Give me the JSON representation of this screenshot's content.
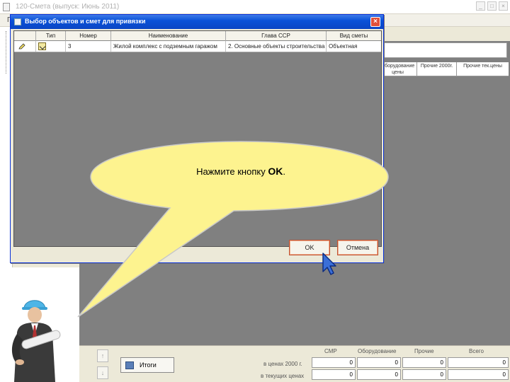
{
  "main_window": {
    "title": "120-Смета (выпуск: Июнь 2011)",
    "menu_letter": "П",
    "window_buttons": [
      "_",
      "□",
      "×"
    ]
  },
  "background_grid": {
    "headers": [
      "Оборудование цены",
      "Прочие 2000г.",
      "Прочие тек.цены"
    ]
  },
  "totals": {
    "up_arrow": "↑",
    "down_arrow": "↓",
    "itogi_label": "Итоги",
    "column_headers": [
      "СМР",
      "Оборудование",
      "Прочие",
      "Всего"
    ],
    "rows": [
      {
        "label": "в ценах 2000 г.",
        "values": [
          "0",
          "0",
          "0",
          "0"
        ]
      },
      {
        "label": "в текущих ценах",
        "values": [
          "0",
          "0",
          "0",
          "0"
        ]
      }
    ]
  },
  "dialog": {
    "title": "Выбор объектов и смет для привязки",
    "close_label": "×",
    "columns": [
      "",
      "Тип",
      "Номер",
      "Наименование",
      "Глава ССР",
      "Вид сметы"
    ],
    "rows": [
      {
        "type_icon": "object-icon",
        "number": "3",
        "name": "Жилой комплекс с подземным гаражом",
        "chapter": "2. Основные объекты строительства",
        "kind": "Объектная"
      }
    ],
    "ok_label": "OK",
    "cancel_label": "Отмена"
  },
  "callout": {
    "text_before": "Нажмите кнопку ",
    "text_bold": "OK",
    "text_after": ".",
    "fill_color": "#fdf38f",
    "stroke_color": "#c8c8c8"
  }
}
